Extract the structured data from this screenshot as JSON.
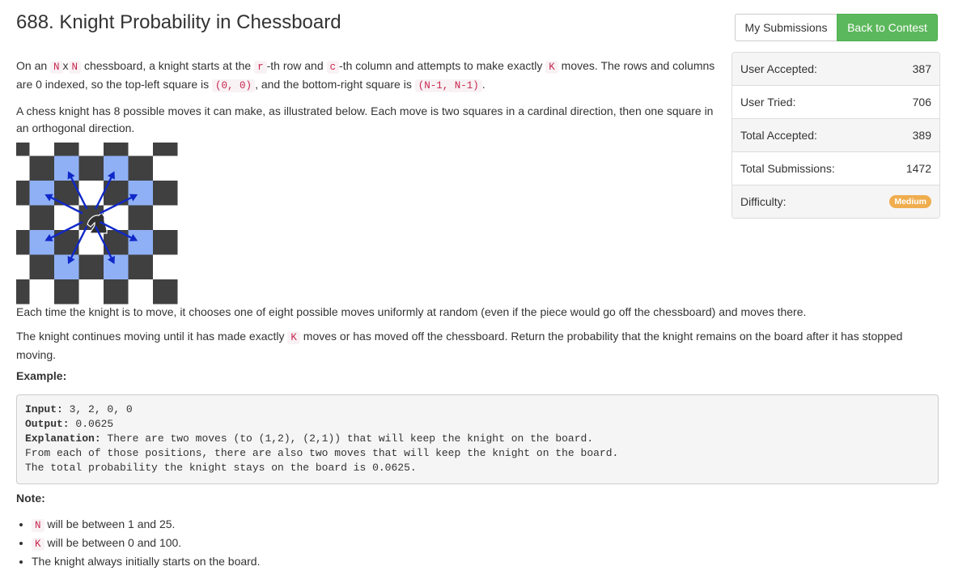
{
  "problem": {
    "title": "688. Knight Probability in Chessboard"
  },
  "buttons": {
    "my_submissions": "My Submissions",
    "back_to_contest": "Back to Contest"
  },
  "stats": {
    "user_accepted_label": "User Accepted:",
    "user_accepted": "387",
    "user_tried_label": "User Tried:",
    "user_tried": "706",
    "total_accepted_label": "Total Accepted:",
    "total_accepted": "389",
    "total_submissions_label": "Total Submissions:",
    "total_submissions": "1472",
    "difficulty_label": "Difficulty:",
    "difficulty": "Medium"
  },
  "desc": {
    "p1": [
      "On an ",
      "N",
      "x",
      "N",
      " chessboard, a knight starts at the ",
      "r",
      "-th row and ",
      "c",
      "-th column and attempts to make exactly ",
      "K",
      " moves. The rows and columns are 0 indexed, so the top-left square is ",
      "(0, 0)",
      ", and the bottom-right square is ",
      "(N-1, N-1)",
      "."
    ],
    "p2": "A chess knight has 8 possible moves it can make, as illustrated below. Each move is two squares in a cardinal direction, then one square in an orthogonal direction.",
    "p3": "Each time the knight is to move, it chooses one of eight possible moves uniformly at random (even if the piece would go off the chessboard) and moves there.",
    "p4": [
      "The knight continues moving until it has made exactly ",
      "K",
      " moves or has moved off the chessboard. Return the probability that the knight remains on the board after it has stopped moving."
    ]
  },
  "example": {
    "heading": "Example:",
    "input_label": "Input:",
    "input": " 3, 2, 0, 0",
    "output_label": "Output:",
    "output": " 0.0625",
    "explanation_label": "Explanation:",
    "explanation": " There are two moves (to (1,2), (2,1)) that will keep the knight on the board.",
    "line2": "From each of those positions, there are also two moves that will keep the knight on the board.",
    "line3": "The total probability the knight stays on the board is 0.0625."
  },
  "note": {
    "heading": "Note:",
    "items": [
      [
        "",
        "N",
        " will be between 1 and 25."
      ],
      [
        "",
        "K",
        " will be between 0 and 100."
      ],
      [
        "The knight always initially starts on the board.",
        "",
        ""
      ]
    ]
  },
  "colors": {
    "dark": "#404040",
    "light": "#ffffff",
    "highlight": "#8fb0f5",
    "arrow": "#1028c8",
    "success": "#5cb85c",
    "badge": "#f0ad4e"
  },
  "icons": {
    "knight": "chess-knight-icon"
  }
}
